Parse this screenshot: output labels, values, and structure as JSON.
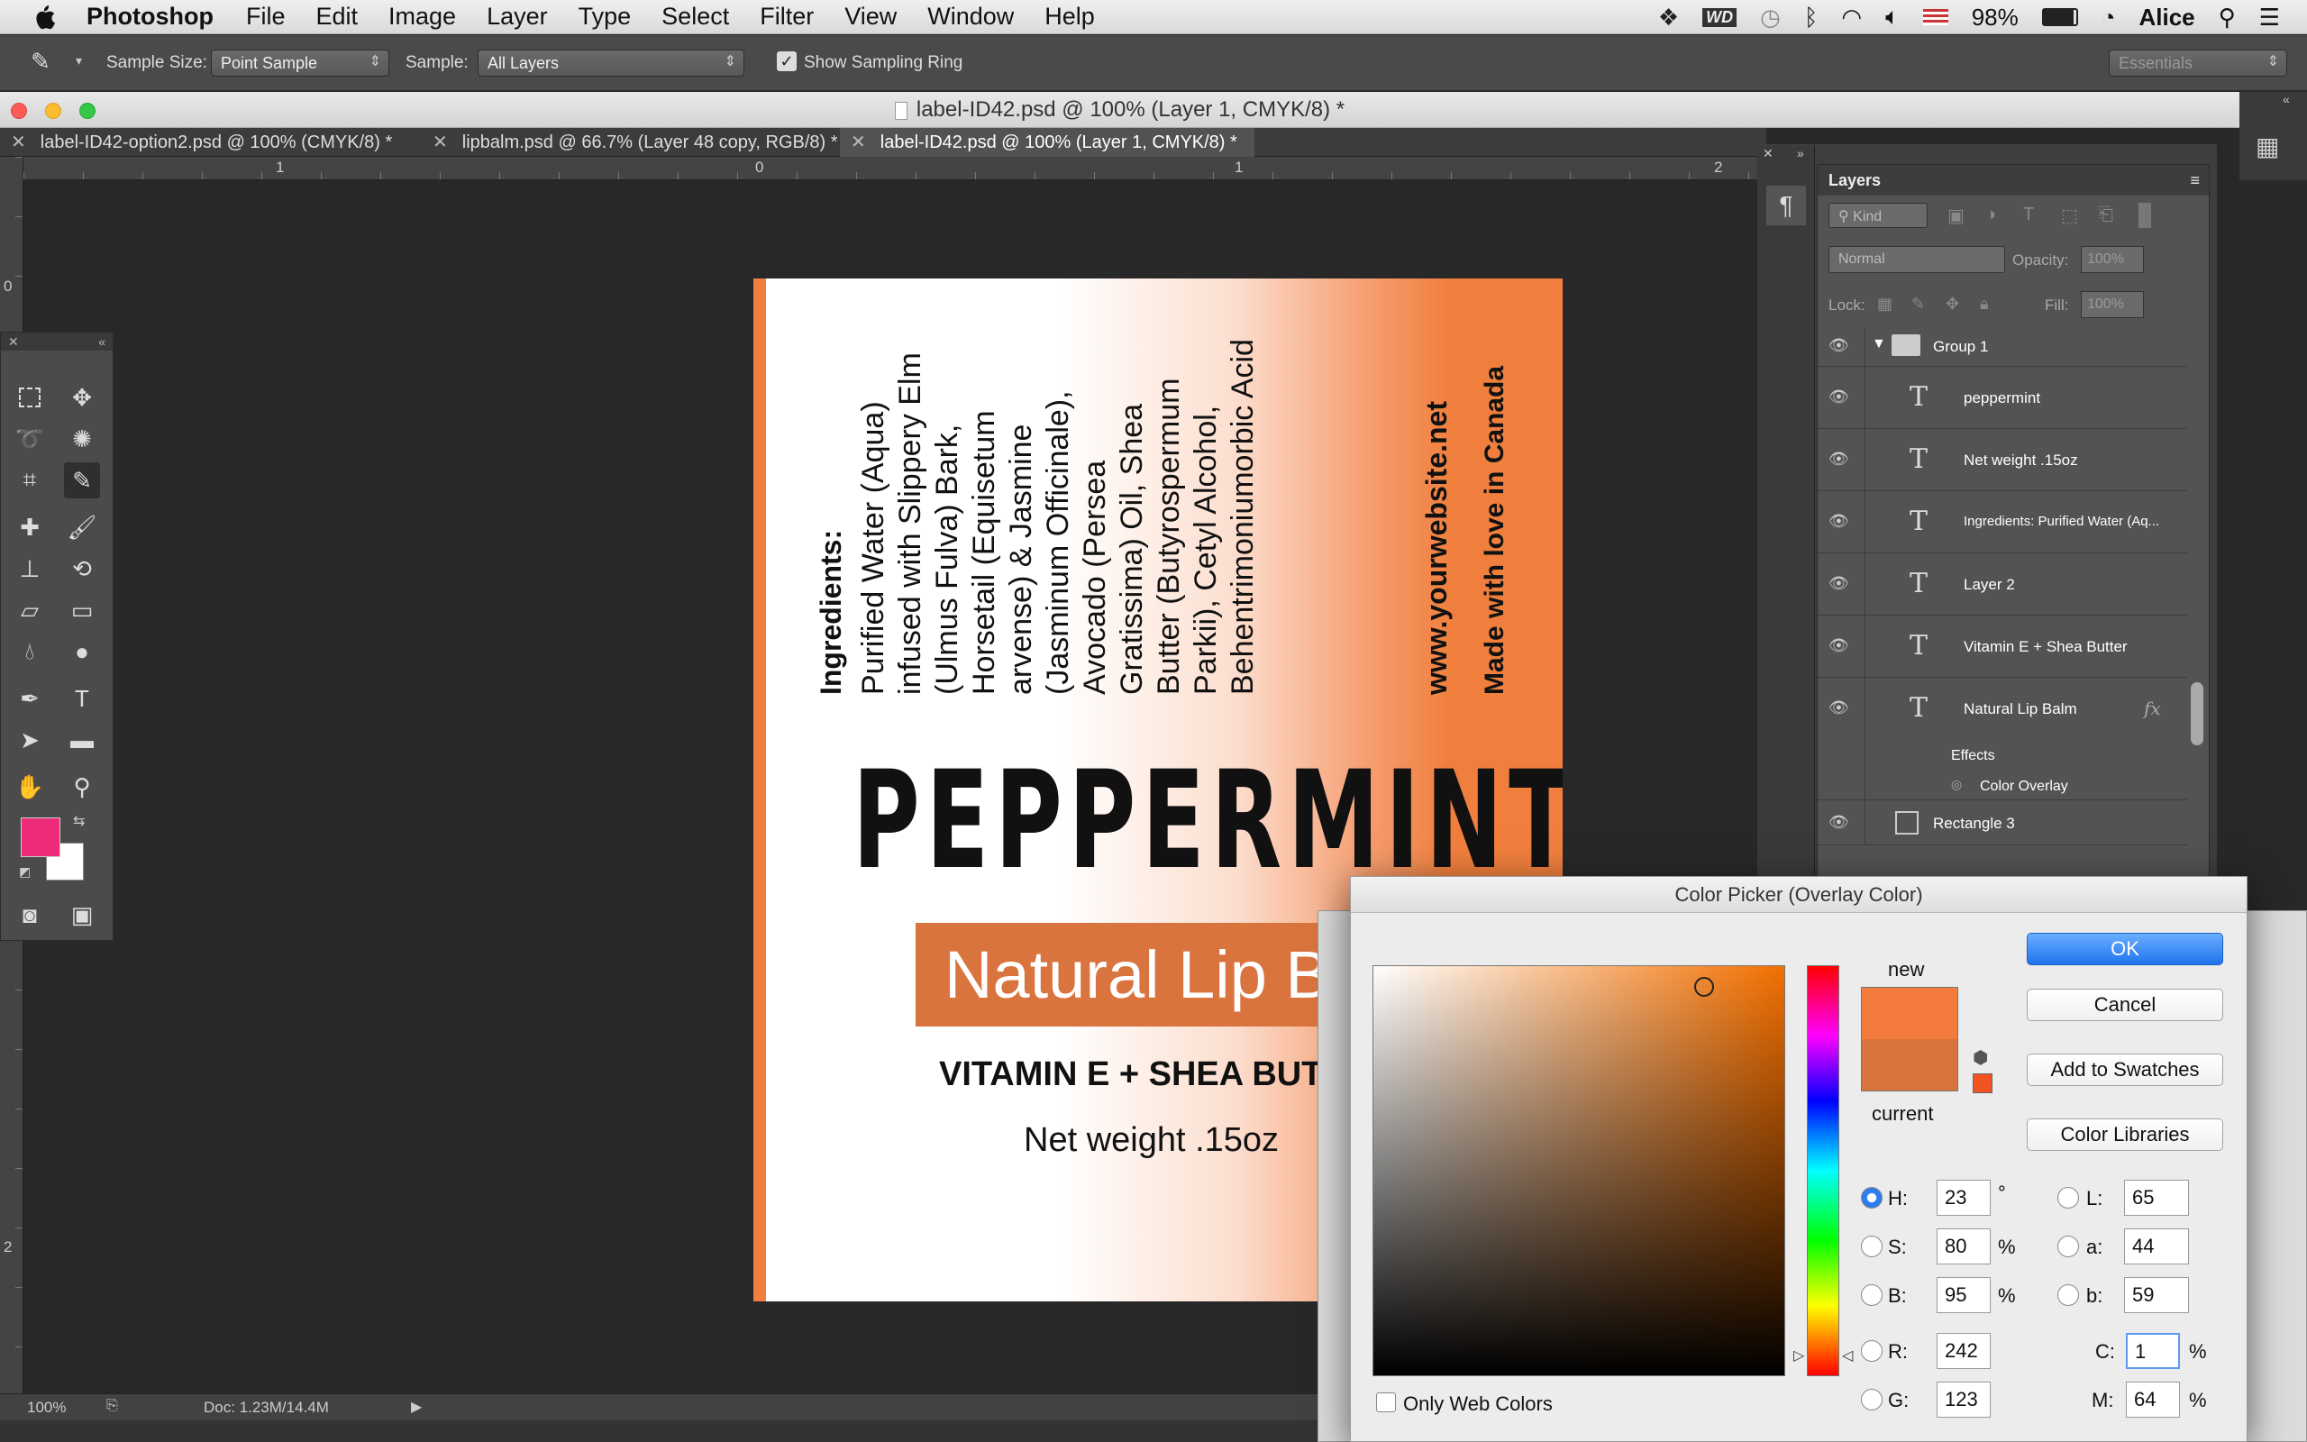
{
  "menubar": {
    "app": "Photoshop",
    "items": [
      "File",
      "Edit",
      "Image",
      "Layer",
      "Type",
      "Select",
      "Filter",
      "View",
      "Window",
      "Help"
    ],
    "battery": "98%",
    "user": "Alice"
  },
  "options": {
    "sample_size_label": "Sample Size:",
    "sample_size_value": "Point Sample",
    "sample_label": "Sample:",
    "sample_value": "All Layers",
    "show_ring": "Show Sampling Ring",
    "workspace": "Essentials"
  },
  "window": {
    "title": "label-ID42.psd @ 100% (Layer 1, CMYK/8) *"
  },
  "tabs": [
    "label-ID42-option2.psd @ 100% (CMYK/8) *",
    "lipbalm.psd @ 66.7% (Layer 48 copy, RGB/8) *",
    "label-ID42.psd @ 100% (Layer 1, CMYK/8) *"
  ],
  "ruler": {
    "h": [
      "1",
      "0",
      "1",
      "2"
    ],
    "v": [
      "0",
      "2"
    ]
  },
  "label": {
    "ingredients_head": "Ingredients:",
    "ingredients": [
      "Purified Water (Aqua)",
      "infused with Slippery Elm",
      "(Ulmus Fulva) Bark,",
      "Horsetail (Equisetum",
      "arvense) & Jasmine",
      "(Jasminum Officinale),",
      "Avocado (Persea",
      "Gratissima) Oil, Shea",
      "Butter (Butyrospermum",
      "Parkii), Cetyl Alcohol,",
      "Behentrimoniumorbic Acid"
    ],
    "website": "www.yourwebsite.net",
    "made": "Made with love in Canada",
    "title": "PEPPERMINT",
    "subtitle": "Natural Lip Ba",
    "vitamin": "VITAMIN E + SHEA BUT",
    "weight": "Net weight .15oz"
  },
  "status": {
    "zoom": "100%",
    "doc": "Doc: 1.23M/14.4M"
  },
  "layers": {
    "title": "Layers",
    "kind": "Kind",
    "blend": "Normal",
    "opacity_label": "Opacity:",
    "opacity": "100%",
    "lock_label": "Lock:",
    "fill_label": "Fill:",
    "fill": "100%",
    "group": "Group 1",
    "rows": [
      "peppermint",
      "Net weight .15oz",
      "Ingredients:  Purified Water (Aq...",
      "Layer 2",
      "Vitamin E + Shea Butter",
      "Natural Lip Balm"
    ],
    "effects": "Effects",
    "color_overlay": "Color Overlay",
    "rect": "Rectangle 3",
    "fx": "fx"
  },
  "picker": {
    "title": "Color Picker (Overlay Color)",
    "ok": "OK",
    "cancel": "Cancel",
    "add": "Add to Swatches",
    "libraries": "Color Libraries",
    "new": "new",
    "current": "current",
    "web": "Only Web Colors",
    "h": "23",
    "s": "80",
    "b": "95",
    "r": "242",
    "g": "123",
    "l": "65",
    "a": "44",
    "bb": "59",
    "c": "1",
    "m": "64",
    "deg": "°",
    "pct": "%",
    "new_color": "#f27b3d",
    "current_color": "#d9733d",
    "hue_color": "#f26f00"
  },
  "colors": {
    "foreground": "#ee2a7b",
    "background": "#ffffff"
  }
}
